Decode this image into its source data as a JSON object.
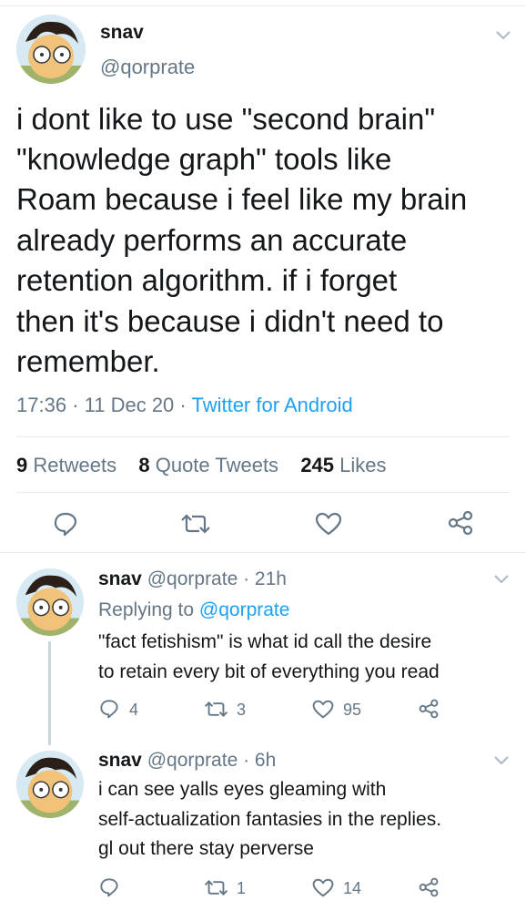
{
  "main_tweet": {
    "display_name": "snav",
    "handle": "@qorprate",
    "text_lines": [
      "i dont like to use \"second brain\"",
      "\"knowledge graph\" tools like",
      "Roam because i feel like my brain",
      "already performs an accurate",
      "retention algorithm. if i forget",
      "then it's because i didn't need to",
      "remember."
    ],
    "time": "17:36",
    "date": "11 Dec 20",
    "source": "Twitter for Android",
    "retweets_count": "9",
    "retweets_label": "Retweets",
    "quotes_count": "8",
    "quotes_label": "Quote Tweets",
    "likes_count": "245",
    "likes_label": "Likes"
  },
  "replies": [
    {
      "display_name": "snav",
      "handle_time": "@qorprate · 21h",
      "replying_prefix": "Replying to ",
      "replying_handle": "@qorprate",
      "text_lines": [
        "\"fact fetishism\" is what id call the desire",
        "to retain every bit of everything you read"
      ],
      "reply_count": "4",
      "retweet_count": "3",
      "like_count": "95"
    },
    {
      "display_name": "snav",
      "handle_time": "@qorprate · 6h",
      "text_lines": [
        "i can see yalls eyes gleaming with",
        "self-actualization fantasies in the replies.",
        "gl out there stay perverse"
      ],
      "reply_count": "",
      "retweet_count": "1",
      "like_count": "14"
    }
  ],
  "colors": {
    "accent": "#1da1f2",
    "text": "#14171a",
    "secondary": "#657786",
    "divider": "#e6ecf0"
  },
  "icons": [
    "chevron-down-icon",
    "reply-icon",
    "retweet-icon",
    "like-icon",
    "share-icon"
  ]
}
